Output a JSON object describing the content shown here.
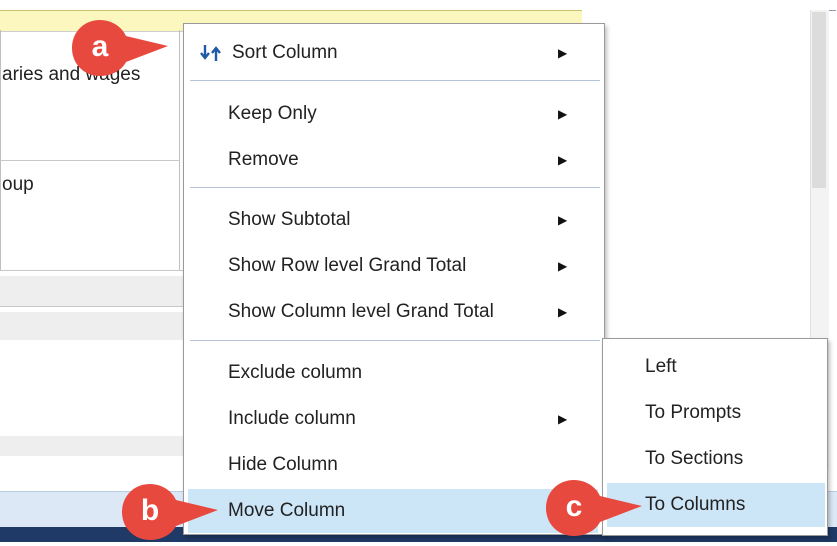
{
  "background": {
    "header_snippet": "\"",
    "cell_text_1": "aries and wages",
    "cell_text_2": "oup"
  },
  "menu": {
    "items": [
      {
        "label": "Sort Column",
        "has_submenu": true,
        "icon": "sort-arrows-icon"
      },
      {
        "label": "Keep Only",
        "has_submenu": true
      },
      {
        "label": "Remove",
        "has_submenu": true
      },
      {
        "label": "Show Subtotal",
        "has_submenu": true
      },
      {
        "label": "Show Row level Grand Total",
        "has_submenu": true
      },
      {
        "label": "Show Column level Grand Total",
        "has_submenu": true
      },
      {
        "label": "Exclude column",
        "has_submenu": false
      },
      {
        "label": "Include column",
        "has_submenu": true
      },
      {
        "label": "Hide Column",
        "has_submenu": false
      },
      {
        "label": "Move Column",
        "has_submenu": true,
        "highlighted": true
      }
    ],
    "arrow_glyph": "▶"
  },
  "submenu": {
    "items": [
      {
        "label": "Left"
      },
      {
        "label": "To Prompts"
      },
      {
        "label": "To Sections"
      },
      {
        "label": "To Columns",
        "highlighted": true
      }
    ]
  },
  "callouts": {
    "a": "a",
    "b": "b",
    "c": "c",
    "color": "#e8493f"
  },
  "colors": {
    "highlight": "#cde6f7",
    "header_yellow": "#fbf7bf",
    "footer_blue": "#1f3a66"
  }
}
